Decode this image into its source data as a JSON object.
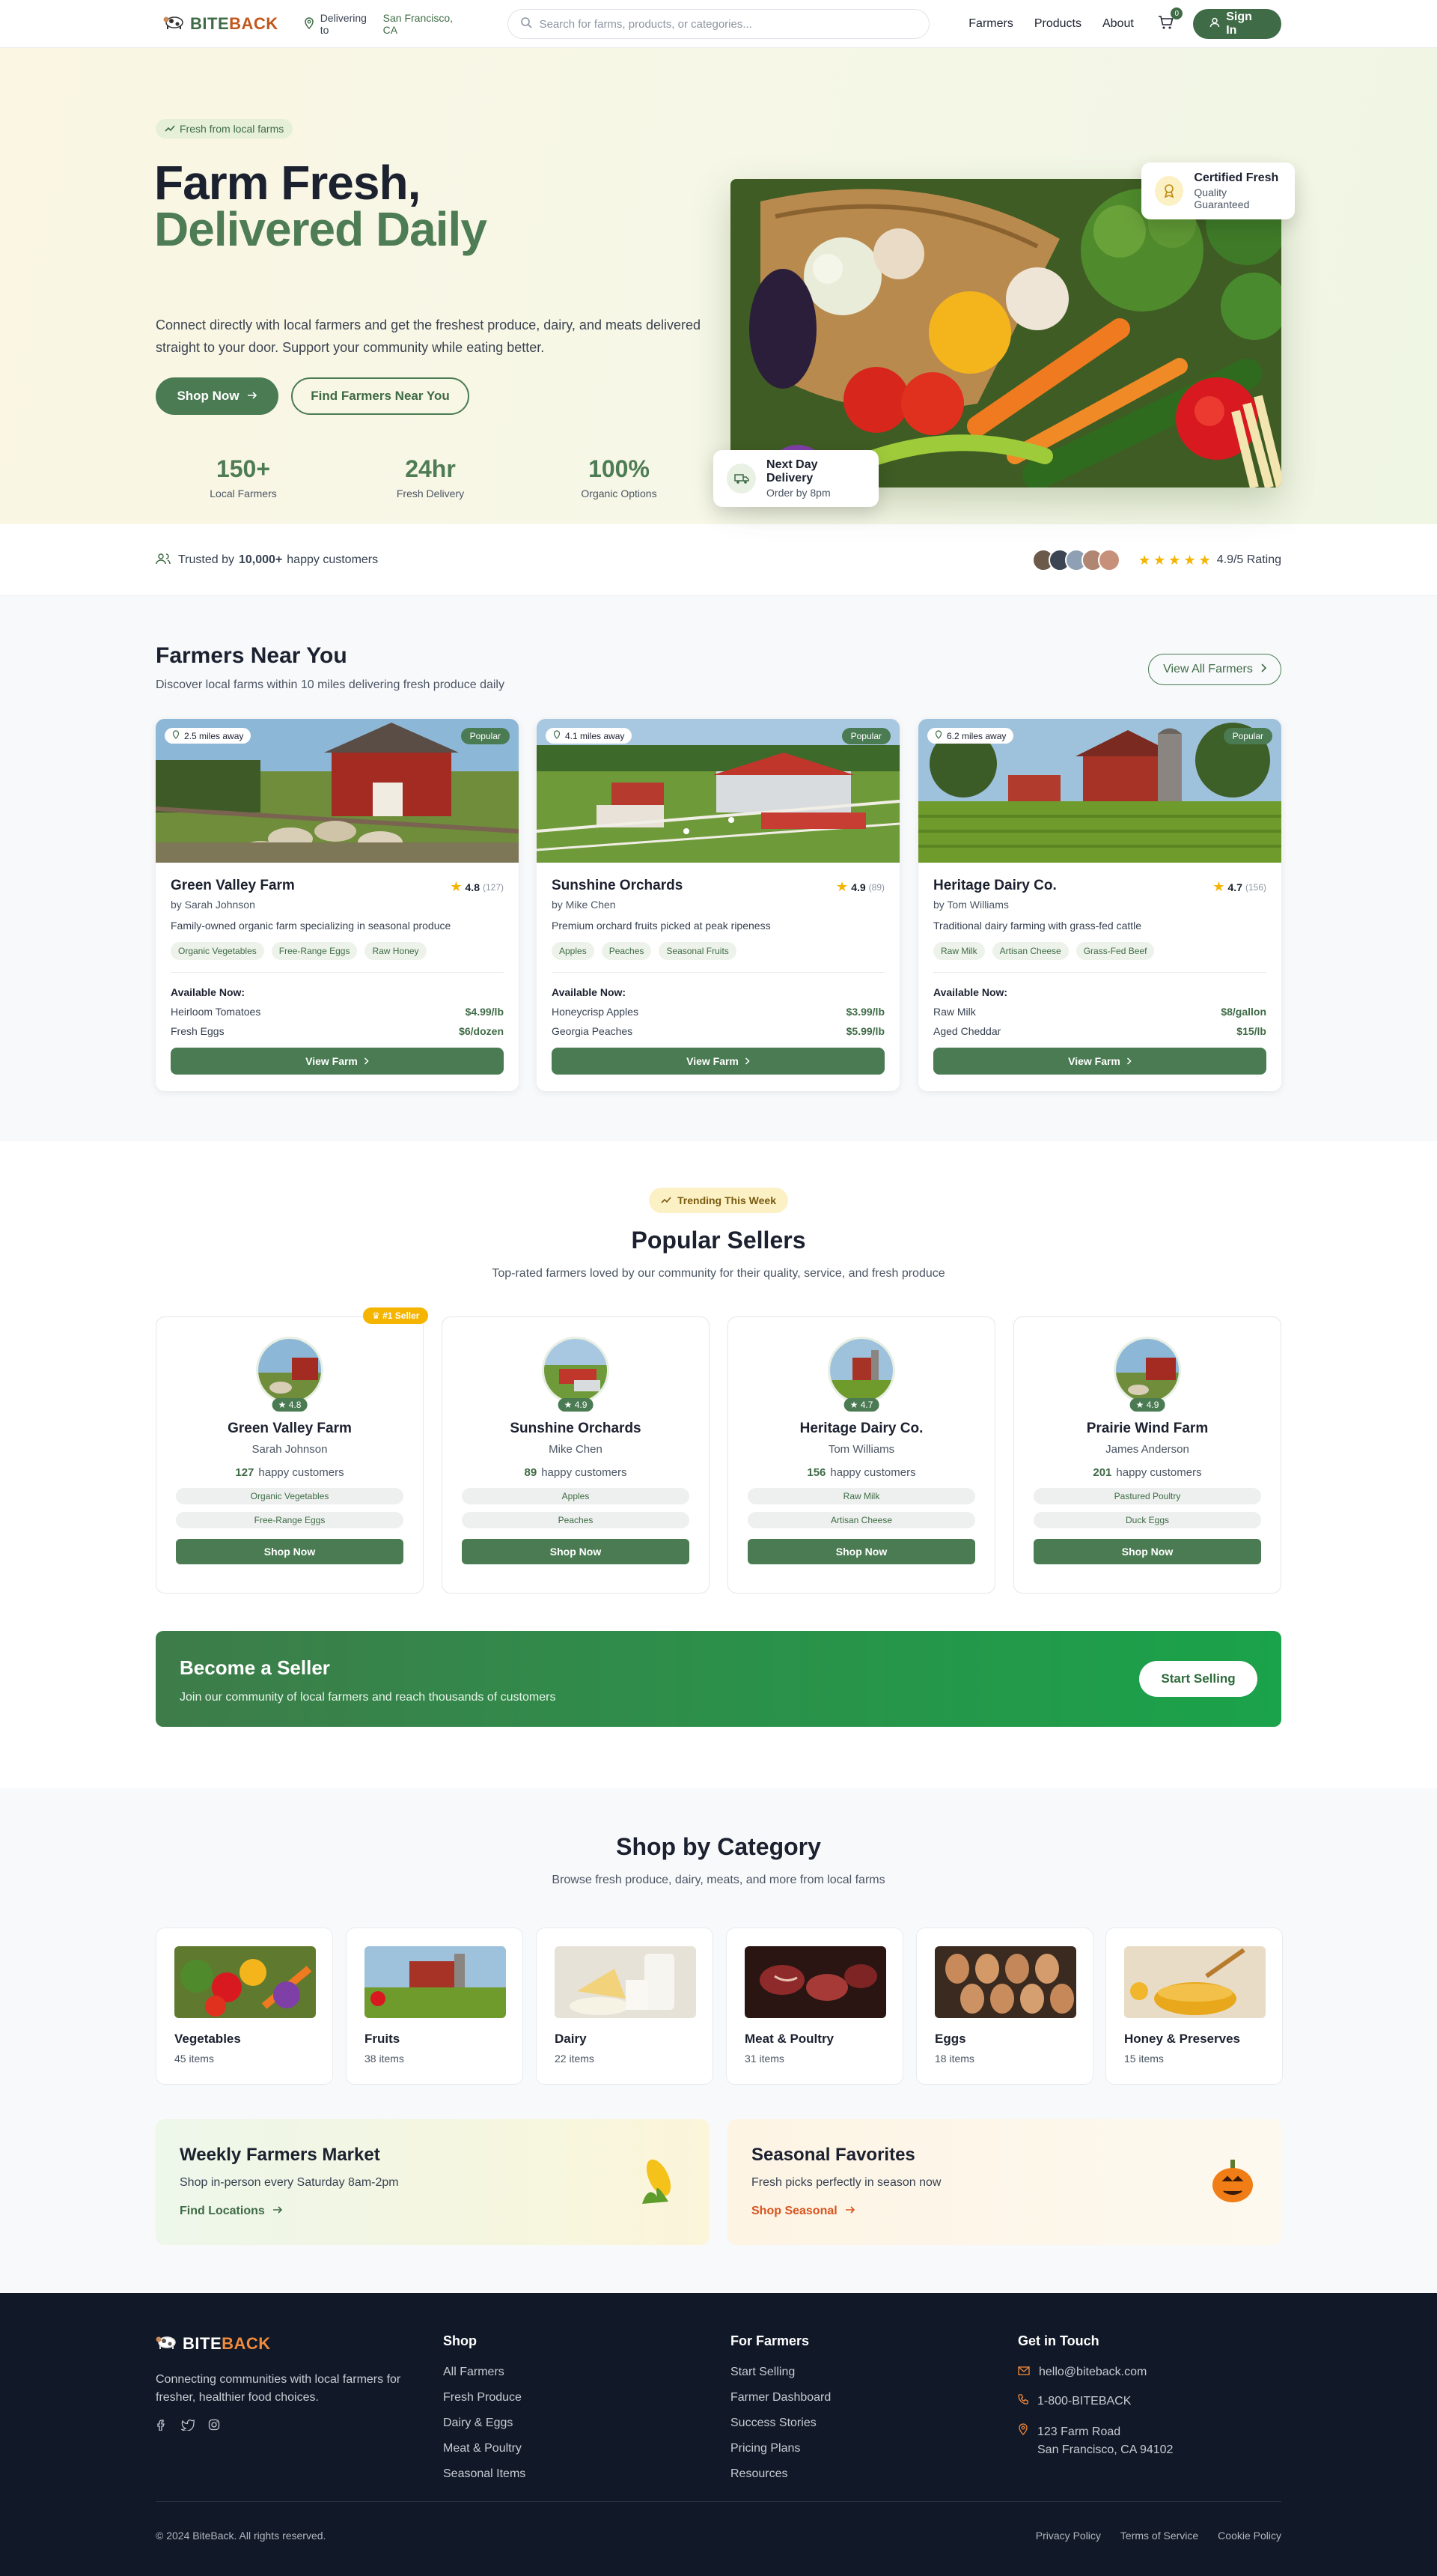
{
  "header": {
    "brand_a": "BITE",
    "brand_b": "BACK",
    "delivering_to": "Delivering to",
    "location": "San Francisco, CA",
    "search_placeholder": "Search for farms, products, or categories...",
    "nav": [
      "Farmers",
      "Products",
      "About"
    ],
    "cart_count": "0",
    "sign_in": "Sign In"
  },
  "hero": {
    "pill": "Fresh from local farms",
    "title_1": "Farm Fresh,",
    "title_2": "Delivered Daily",
    "lead": "Connect directly with local farmers and get the freshest produce, dairy, and meats delivered straight to your door. Support your community while eating better.",
    "shop_now": "Shop Now",
    "find_farmers": "Find Farmers Near You",
    "stats": [
      {
        "n": "150+",
        "l": "Local Farmers"
      },
      {
        "n": "24hr",
        "l": "Fresh Delivery"
      },
      {
        "n": "100%",
        "l": "Organic Options"
      }
    ],
    "certified_title": "Certified Fresh",
    "certified_sub": "Quality Guaranteed",
    "delivery_title": "Next Day Delivery",
    "delivery_sub": "Order by 8pm"
  },
  "trust": {
    "pre": "Trusted by",
    "count": "10,000+",
    "post": "happy customers",
    "rating": "4.9/5 Rating"
  },
  "farmers": {
    "title": "Farmers Near You",
    "subtitle": "Discover local farms within 10 miles delivering fresh produce daily",
    "view_all": "View All Farmers",
    "available": "Available Now:",
    "view_farm": "View Farm",
    "popular": "Popular",
    "items": [
      {
        "miles": "2.5 miles away",
        "name": "Green Valley Farm",
        "rating": "4.8",
        "reviews": "(127)",
        "by": "by Sarah Johnson",
        "desc": "Family-owned organic farm specializing in seasonal produce",
        "tags": [
          "Organic Vegetables",
          "Free-Range Eggs",
          "Raw Honey"
        ],
        "products": [
          {
            "n": "Heirloom Tomatoes",
            "p": "$4.99/lb"
          },
          {
            "n": "Fresh Eggs",
            "p": "$6/dozen"
          }
        ]
      },
      {
        "miles": "4.1 miles away",
        "name": "Sunshine Orchards",
        "rating": "4.9",
        "reviews": "(89)",
        "by": "by Mike Chen",
        "desc": "Premium orchard fruits picked at peak ripeness",
        "tags": [
          "Apples",
          "Peaches",
          "Seasonal Fruits"
        ],
        "products": [
          {
            "n": "Honeycrisp Apples",
            "p": "$3.99/lb"
          },
          {
            "n": "Georgia Peaches",
            "p": "$5.99/lb"
          }
        ]
      },
      {
        "miles": "6.2 miles away",
        "name": "Heritage Dairy Co.",
        "rating": "4.7",
        "reviews": "(156)",
        "by": "by Tom Williams",
        "desc": "Traditional dairy farming with grass-fed cattle",
        "tags": [
          "Raw Milk",
          "Artisan Cheese",
          "Grass-Fed Beef"
        ],
        "products": [
          {
            "n": "Raw Milk",
            "p": "$8/gallon"
          },
          {
            "n": "Aged Cheddar",
            "p": "$15/lb"
          }
        ]
      }
    ]
  },
  "sellers": {
    "trending": "Trending This Week",
    "title": "Popular Sellers",
    "subtitle": "Top-rated farmers loved by our community for their quality, service, and fresh produce",
    "first_badge": "#1 Seller",
    "customers_label": "happy customers",
    "shop_now": "Shop Now",
    "items": [
      {
        "name": "Green Valley Farm",
        "owner": "Sarah Johnson",
        "rating": "4.8",
        "customers": "127",
        "tags": [
          "Organic Vegetables",
          "Free-Range Eggs"
        ]
      },
      {
        "name": "Sunshine Orchards",
        "owner": "Mike Chen",
        "rating": "4.9",
        "customers": "89",
        "tags": [
          "Apples",
          "Peaches"
        ]
      },
      {
        "name": "Heritage Dairy Co.",
        "owner": "Tom Williams",
        "rating": "4.7",
        "customers": "156",
        "tags": [
          "Raw Milk",
          "Artisan Cheese"
        ]
      },
      {
        "name": "Prairie Wind Farm",
        "owner": "James Anderson",
        "rating": "4.9",
        "customers": "201",
        "tags": [
          "Pastured Poultry",
          "Duck Eggs"
        ]
      }
    ],
    "become_title": "Become a Seller",
    "become_sub": "Join our community of local farmers and reach thousands of customers",
    "start_selling": "Start Selling"
  },
  "categories": {
    "title": "Shop by Category",
    "subtitle": "Browse fresh produce, dairy, meats, and more from local farms",
    "items": [
      {
        "n": "Vegetables",
        "c": "45 items"
      },
      {
        "n": "Fruits",
        "c": "38 items"
      },
      {
        "n": "Dairy",
        "c": "22 items"
      },
      {
        "n": "Meat & Poultry",
        "c": "31 items"
      },
      {
        "n": "Eggs",
        "c": "18 items"
      },
      {
        "n": "Honey & Preserves",
        "c": "15 items"
      }
    ],
    "promo1": {
      "title": "Weekly Farmers Market",
      "sub": "Shop in-person every Saturday 8am-2pm",
      "link": "Find Locations"
    },
    "promo2": {
      "title": "Seasonal Favorites",
      "sub": "Fresh picks perfectly in season now",
      "link": "Shop Seasonal"
    }
  },
  "footer": {
    "tagline": "Connecting communities with local farmers for fresher, healthier food choices.",
    "shop_title": "Shop",
    "shop": [
      "All Farmers",
      "Fresh Produce",
      "Dairy & Eggs",
      "Meat & Poultry",
      "Seasonal Items"
    ],
    "farmers_title": "For Farmers",
    "farmers": [
      "Start Selling",
      "Farmer Dashboard",
      "Success Stories",
      "Pricing Plans",
      "Resources"
    ],
    "contact_title": "Get in Touch",
    "email": "hello@biteback.com",
    "phone": "1-800-BITEBACK",
    "addr1": "123 Farm Road",
    "addr2": "San Francisco, CA 94102",
    "copyright": "© 2024 BiteBack. All rights reserved.",
    "legal": [
      "Privacy Policy",
      "Terms of Service",
      "Cookie Policy"
    ]
  },
  "colors": {
    "primary": "#4a7b52",
    "accent": "#c2571c",
    "star": "#f4b400",
    "footer_bg": "#111827"
  }
}
